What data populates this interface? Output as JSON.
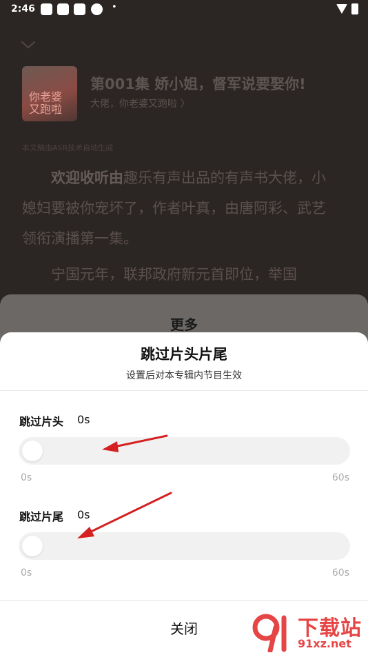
{
  "status_bar": {
    "time": "2:46"
  },
  "player": {
    "episode_title": "第001集 娇小姐，督军说要娶你!",
    "album_link": "大佬，你老婆又跑啦 〉",
    "cover_text": "你老婆\n又跑啦",
    "asr_note": "本文稿由ASR技术自动生成",
    "transcript_bold": "欢迎收听由",
    "transcript_rest": "趣乐有声出品的有声书大佬，小媳妇要被你宠坏了，作者叶真，由唐阿彩、武艺领衔演播第一集。",
    "transcript_2": "宁国元年，联邦政府新元首即位，举国"
  },
  "more_sheet": {
    "title": "更多"
  },
  "skip_sheet": {
    "title": "跳过片头片尾",
    "subtitle": "设置后对本专辑内节目生效",
    "intro": {
      "label": "跳过片头",
      "value_text": "0s",
      "level": 0.0,
      "min_label": "0s",
      "max_label": "60s"
    },
    "outro": {
      "label": "跳过片尾",
      "value_text": "0s",
      "level": 0.0,
      "min_label": "0s",
      "max_label": "60s"
    },
    "close_label": "关闭"
  },
  "watermark": {
    "text": "下载站",
    "url": "91xz.net",
    "logo_text": "9"
  },
  "colors": {
    "accent_fill": "#f7c9c4",
    "arrow": "#d42020",
    "watermark": "#e64545"
  }
}
